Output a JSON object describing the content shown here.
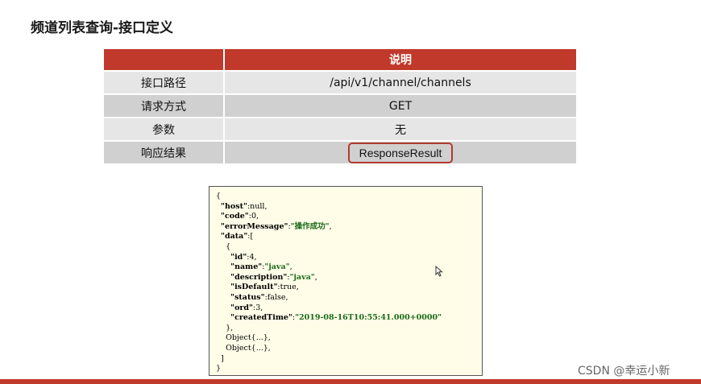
{
  "title": "频道列表查询-接口定义",
  "table": {
    "header": [
      "",
      "说明"
    ],
    "rows": [
      {
        "label": "接口路径",
        "value": "/api/v1/channel/channels"
      },
      {
        "label": "请求方式",
        "value": "GET"
      },
      {
        "label": "参数",
        "value": "无"
      },
      {
        "label": "响应结果",
        "value": "ResponseResult"
      }
    ]
  },
  "json_lines": [
    "{",
    "  \"host\":null,",
    "  \"code\":0,",
    "  \"errorMessage\":\"操作成功\",",
    "  \"data\":[",
    "    {",
    "      \"id\":4,",
    "      \"name\":\"java\",",
    "      \"description\":\"java\",",
    "      \"isDefault\":true,",
    "      \"status\":false,",
    "      \"ord\":3,",
    "      \"createdTime\":\"2019-08-16T10:55:41.000+0000\"",
    "    },",
    "    Object{...},",
    "    Object{...},",
    "  ]",
    "}"
  ],
  "watermark": "CSDN @幸运小新",
  "colors": {
    "accent": "#c0392b",
    "json_bg": "#fffde8",
    "string": "#1a6b1a"
  }
}
